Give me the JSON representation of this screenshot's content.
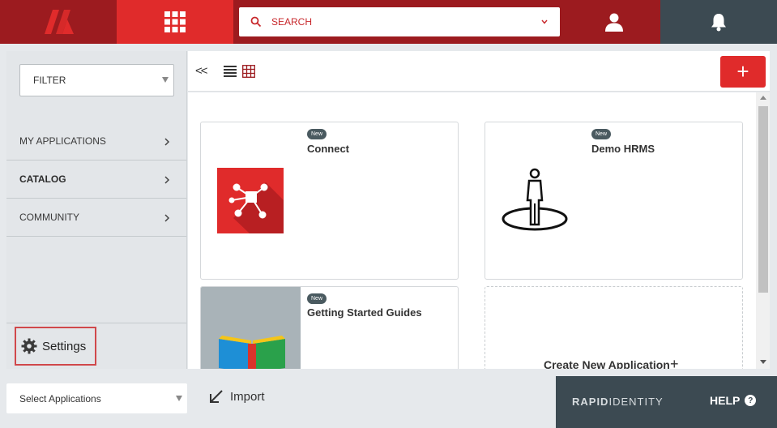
{
  "header": {
    "search_placeholder": "SEARCH",
    "logo_icon": "rapididentity-logo-icon",
    "apps_icon": "app-grid-icon",
    "user_icon": "user-icon",
    "bell_icon": "bell-icon"
  },
  "sidebar": {
    "filter_label": "FILTER",
    "items": [
      {
        "label": "MY APPLICATIONS",
        "bold": false
      },
      {
        "label": "CATALOG",
        "bold": true
      },
      {
        "label": "COMMUNITY",
        "bold": false
      }
    ],
    "settings_label": "Settings"
  },
  "toolbar": {
    "collapse_label": "<<",
    "add_label": "+"
  },
  "cards": [
    {
      "badge": "New",
      "title": "Connect"
    },
    {
      "badge": "New",
      "title": "Demo HRMS"
    },
    {
      "badge": "New",
      "title": "Getting Started Guides"
    }
  ],
  "create_card": {
    "label": "Create New Application",
    "icon": "+"
  },
  "footer": {
    "select_label": "Select Applications",
    "import_label": "Import",
    "brand_bold": "RAPID",
    "brand_rest": "IDENTITY",
    "help_label": "HELP",
    "help_icon": "?"
  },
  "colors": {
    "brand_red": "#e02b2b",
    "dark_red": "#9c1b1f",
    "slate": "#3c4a52"
  }
}
